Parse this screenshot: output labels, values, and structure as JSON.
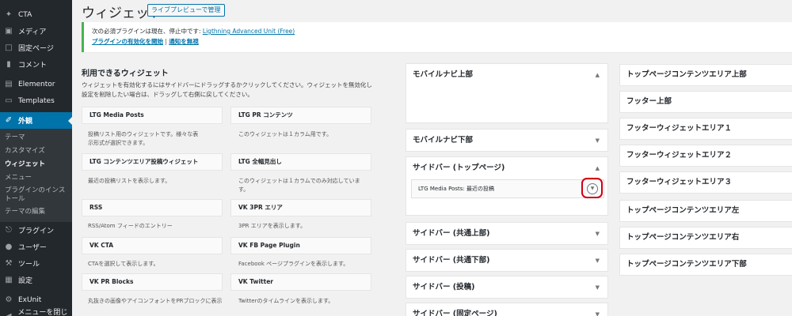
{
  "admin_menu": {
    "items_top": [
      {
        "label": "CTA",
        "icon": "pin-icon"
      },
      {
        "label": "メディア",
        "icon": "media-icon"
      },
      {
        "label": "固定ページ",
        "icon": "page-icon"
      },
      {
        "label": "コメント",
        "icon": "comment-icon"
      }
    ],
    "items_mid": [
      {
        "label": "Elementor",
        "icon": "elementor-icon"
      },
      {
        "label": "Templates",
        "icon": "folder-icon"
      }
    ],
    "active": {
      "label": "外観",
      "icon": "paintbrush-icon"
    },
    "submenu": [
      "テーマ",
      "カスタマイズ",
      "ウィジェット",
      "メニュー",
      "プラグインのインストール",
      "テーマの編集"
    ],
    "items_bottom": [
      {
        "label": "プラグイン",
        "icon": "plugin-icon"
      },
      {
        "label": "ユーザー",
        "icon": "user-icon"
      },
      {
        "label": "ツール",
        "icon": "wrench-icon"
      },
      {
        "label": "設定",
        "icon": "settings-icon"
      }
    ],
    "items_end": [
      {
        "label": "ExUnit",
        "icon": "gear-icon"
      },
      {
        "label": "メニューを閉じる",
        "icon": "collapse-icon"
      }
    ]
  },
  "page": {
    "title": "ウィジェット",
    "action": "ライブプレビューで管理"
  },
  "notice": {
    "line1_text": "次の必須プラグインは現在、停止中です: ",
    "line1_link": "Ligthning Advanced Unit (Free)",
    "link_activate": "プラグインの有効化を開始",
    "separator": " | ",
    "link_dismiss": "通知を無視"
  },
  "available": {
    "title": "利用できるウィジェット",
    "description": "ウィジェットを有効化するにはサイドバーにドラッグするかクリックしてください。ウィジェットを無効化し設定を削除したい場合は、ドラッグして右側に戻してください。",
    "widgets": [
      {
        "name": "LTG Media Posts",
        "desc": "投稿リスト用のウィジェットです。様々な表示形式が選択できます。"
      },
      {
        "name": "LTG PR コンテンツ",
        "desc": "このウィジェットは１カラム用です。"
      },
      {
        "name": "LTG コンテンツエリア投稿ウィジェット",
        "desc": "最近の投稿リストを表示します。"
      },
      {
        "name": "LTG 全幅見出し",
        "desc": "このウィジェットは１カラムでのみ対応しています。"
      },
      {
        "name": "RSS",
        "desc": "RSS/Atom フィードのエントリー"
      },
      {
        "name": "VK 3PR エリア",
        "desc": "3PR エリアを表示します。"
      },
      {
        "name": "VK CTA",
        "desc": "CTAを選択して表示します。"
      },
      {
        "name": "VK FB Page Plugin",
        "desc": "Facebook ページプラグインを表示します。"
      },
      {
        "name": "VK PR Blocks",
        "desc": "丸抜きの画像やアイコンフォントをPRブロックに表示"
      },
      {
        "name": "VK Twitter",
        "desc": "Twitterのタイムラインを表示します。"
      }
    ]
  },
  "sidebars": {
    "mobile_top": "モバイルナビ上部",
    "mobile_bottom": "モバイルナビ下部",
    "sidebar_top_page": "サイドバー (トップページ)",
    "inner_widget": "LTG Media Posts: 最近の投稿",
    "sidebar_common_top": "サイドバー (共通上部)",
    "sidebar_common_bottom": "サイドバー (共通下部)",
    "sidebar_post": "サイドバー (投稿)",
    "sidebar_page": "サイドバー (固定ページ)"
  },
  "right_areas": [
    "トップページコンテンツエリア上部",
    "フッター上部",
    "フッターウィジェットエリア１",
    "フッターウィジェットエリア２",
    "フッターウィジェットエリア３",
    "トップページコンテンツエリア左",
    "トップページコンテンツエリア右",
    "トップページコンテンツエリア下部"
  ],
  "colors": {
    "admin_bg": "#23282d",
    "accent": "#0073aa",
    "notice_border": "#46b450",
    "highlight": "#d10015"
  }
}
